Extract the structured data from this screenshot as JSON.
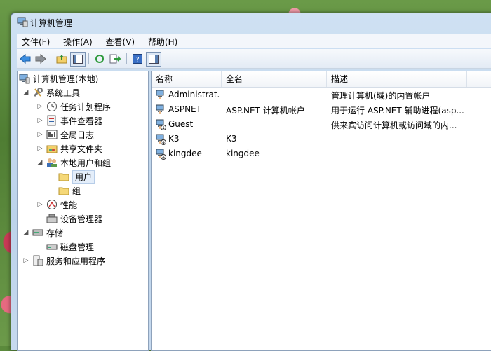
{
  "window": {
    "title": "计算机管理"
  },
  "menu": {
    "items": [
      "文件(F)",
      "操作(A)",
      "查看(V)",
      "帮助(H)"
    ]
  },
  "toolbar": {
    "buttons": [
      "back-arrow-icon",
      "forward-arrow-icon",
      "up-folder-icon",
      "show-hide-tree-icon",
      "refresh-icon",
      "export-list-icon",
      "help-icon",
      "action-pane-icon"
    ]
  },
  "tree": {
    "root": "计算机管理(本地)",
    "system_tools": "系统工具",
    "task_scheduler": "任务计划程序",
    "event_viewer": "事件查看器",
    "global_log": "全局日志",
    "shared_folders": "共享文件夹",
    "local_users_groups": "本地用户和组",
    "users": "用户",
    "groups": "组",
    "performance": "性能",
    "device_manager": "设备管理器",
    "storage": "存储",
    "disk_management": "磁盘管理",
    "services_apps": "服务和应用程序"
  },
  "list": {
    "headers": {
      "name": "名称",
      "fullname": "全名",
      "description": "描述"
    },
    "rows": [
      {
        "name": "Administrat...",
        "fullname": "",
        "description": "管理计算机(域)的内置帐户",
        "disabled": false
      },
      {
        "name": "ASPNET",
        "fullname": "ASP.NET 计算机帐户",
        "description": "用于运行 ASP.NET 辅助进程(asp...",
        "disabled": false
      },
      {
        "name": "Guest",
        "fullname": "",
        "description": "供来宾访问计算机或访问域的内...",
        "disabled": true
      },
      {
        "name": "K3",
        "fullname": "K3",
        "description": "",
        "disabled": true
      },
      {
        "name": "kingdee",
        "fullname": "kingdee",
        "description": "",
        "disabled": true
      }
    ]
  },
  "colors": {
    "selection": "#e4eefa",
    "window_frame": "#bcd3ea"
  }
}
